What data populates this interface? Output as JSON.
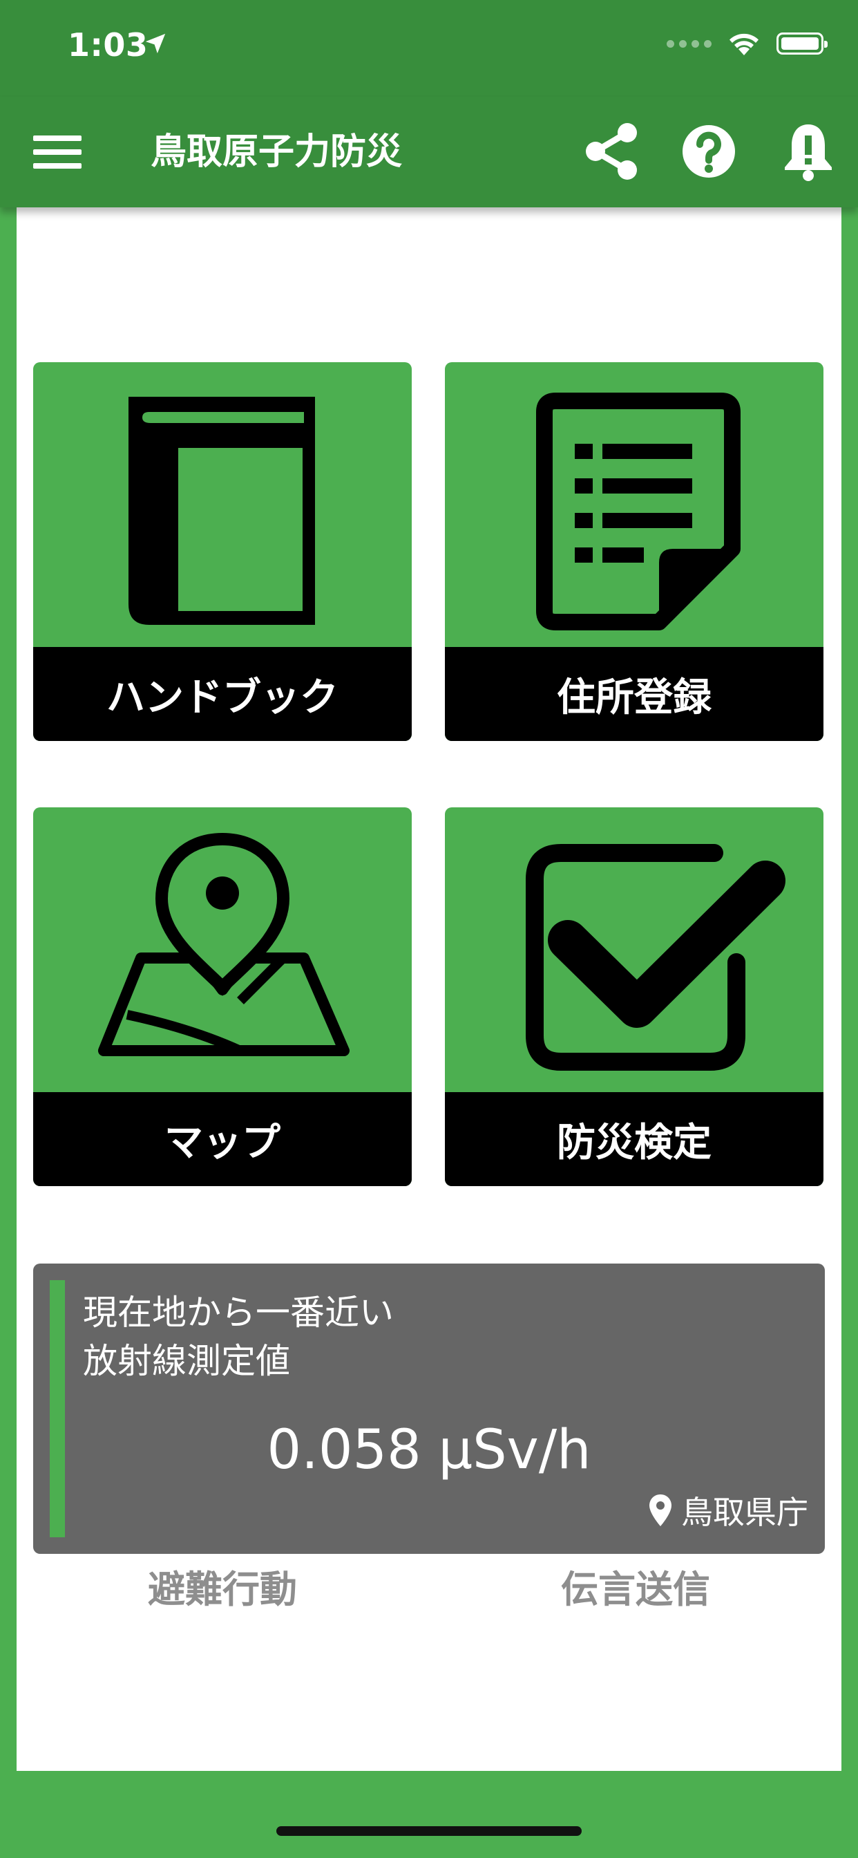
{
  "status_bar": {
    "time": "1:03"
  },
  "app_bar": {
    "title": "鳥取原子力防災"
  },
  "tiles": [
    {
      "label": "ハンドブック",
      "icon": "book-icon"
    },
    {
      "label": "住所登録",
      "icon": "document-list-icon"
    },
    {
      "label": "マップ",
      "icon": "map-pin-icon"
    },
    {
      "label": "防災検定",
      "icon": "checkbox-icon"
    }
  ],
  "radiation": {
    "heading_line1": "現在地から一番近い",
    "heading_line2": "放射線測定値",
    "value": "0.058 μSv/h",
    "location": "鳥取県庁"
  },
  "bottom_links": {
    "evacuation": "避難行動",
    "message": "伝言送信"
  },
  "colors": {
    "primary_dark": "#388e3c",
    "primary": "#4caf50",
    "label_bg": "#000000",
    "card_bg": "#666666",
    "disabled_text": "#8e8e8e"
  }
}
